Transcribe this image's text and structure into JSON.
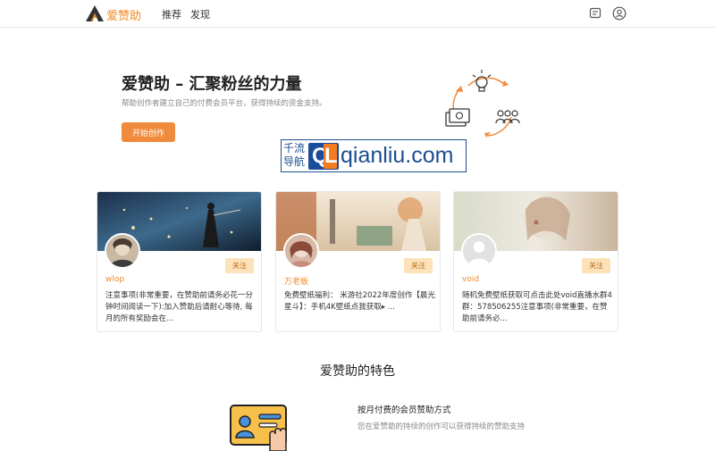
{
  "header": {
    "brand": "爱赞助",
    "nav": [
      "推荐",
      "发现"
    ],
    "icons": [
      "message-icon",
      "user-avatar-icon"
    ],
    "accent_color": "#f08a24"
  },
  "hero": {
    "title": "爱赞助 – 汇聚粉丝的力量",
    "subtitle": "帮助创作者建立自己的付费会员平台，获得持续的资金支持。",
    "cta": "开始创作"
  },
  "watermark": {
    "cn_top": "千流",
    "cn_bottom": "导航",
    "logo_q": "Q",
    "logo_l": "L",
    "domain": "qianliu.com"
  },
  "creators": [
    {
      "name": "wlop",
      "follow": "关注",
      "desc": "注意事项(非常重要，在赞助前请务必花一分钟时间阅读一下):加入赞助后请耐心等待, 每月的所有奖励会在..."
    },
    {
      "name": "万老板",
      "follow": "关注",
      "desc": "免费壁纸福利：  米游社2022年度创作【晨光星斗】：手机4K壁纸点我获取▸ ..."
    },
    {
      "name": "void",
      "follow": "关注",
      "desc": "随机免费壁纸获取可点击此处void直播水群4群：578506255注意事项(非常重要，在赞助前请务必..."
    }
  ],
  "features": {
    "title": "爱赞助的特色",
    "items": [
      {
        "heading": "按月付费的会员赞助方式",
        "desc": "您在爱赞助的持续的创作可以获得持续的赞助支持"
      }
    ]
  }
}
